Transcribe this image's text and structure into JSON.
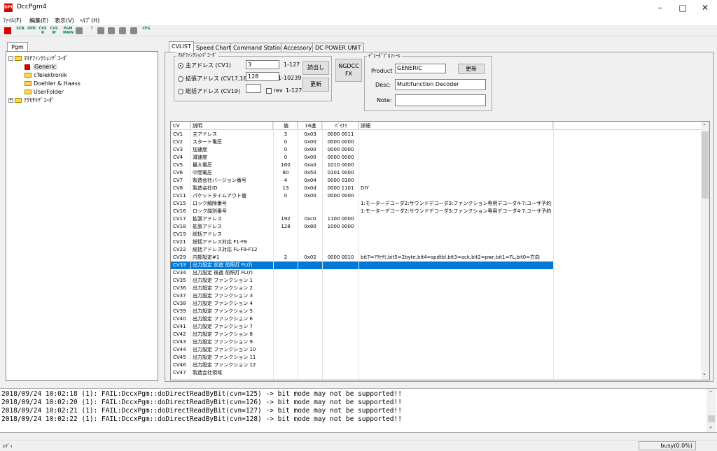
{
  "window": {
    "title": "DccPgm4",
    "icon": "DPG"
  },
  "menu": [
    "ﾌｧｲﾙ(F)",
    "編集(E)",
    "表示(V)",
    "ﾍﾙﾌﾟ(H)"
  ],
  "toolbar": [
    {
      "icon": "stop-icon",
      "label": ""
    },
    {
      "icon": "scn-icon",
      "label": "SCN"
    },
    {
      "icon": "upd-icon",
      "label": "UPD"
    },
    {
      "icon": "cvs-r-icon",
      "label": "CVS R"
    },
    {
      "icon": "cvs-w-icon",
      "label": "CVS W"
    },
    {
      "icon": "pgm-main-icon",
      "label": "PGM MAIN"
    },
    {
      "icon": "print-icon",
      "label": ""
    },
    {
      "icon": "help-icon",
      "label": "?"
    },
    {
      "icon": "copy-icon",
      "label": ""
    },
    {
      "icon": "paste-icon",
      "label": ""
    },
    {
      "icon": "save-icon",
      "label": ""
    },
    {
      "icon": "file-icon",
      "label": ""
    },
    {
      "icon": "cfg-icon",
      "label": "CFG"
    }
  ],
  "left": {
    "tab": "Pgm",
    "tree": [
      {
        "label": "ﾏﾙﾁﾌｧﾝｸｼｮﾝﾃﾞｺｰﾀﾞ",
        "level": 0,
        "expand": "-",
        "icon": "folder"
      },
      {
        "label": "Generic",
        "level": 1,
        "icon": "red",
        "selected": true
      },
      {
        "label": "cTelektronik",
        "level": 1,
        "icon": "folder"
      },
      {
        "label": "Doehler & Haass",
        "level": 1,
        "icon": "folder"
      },
      {
        "label": "UserFolder",
        "level": 1,
        "icon": "folder"
      },
      {
        "label": "ｱｸｾｻﾘﾃﾞｺｰﾀﾞ",
        "level": 0,
        "expand": "+",
        "icon": "folder"
      }
    ]
  },
  "tabs": [
    "CVLIST",
    "Speed Chart",
    "Command Station",
    "Accessory",
    "DC POWER UNIT"
  ],
  "decoder_group": {
    "title": "ﾏﾙﾁﾌｧﾝｸｼｮﾝﾃﾞｺｰﾀﾞ",
    "primary_label": "主アドレス (CV1)",
    "primary_value": "3",
    "primary_range": "1-127",
    "extended_label": "拡張アドレス (CV17,18)",
    "extended_value": "128",
    "extended_range": "1-10239",
    "consist_label": "総括アドレス (CV19)",
    "consist_value": "",
    "rev_label": "rev",
    "consist_range": "1-127",
    "read_button": "読出し",
    "update_button": "更新",
    "selected_mode": "primary"
  },
  "ngdcc_button": "NGDCC FX",
  "profile_group": {
    "title": "ﾃﾞｺｰﾀﾞﾌﾟﾛﾌｨｰﾙ",
    "product_label": "Product",
    "product_value": "GENERIC",
    "update_button": "更新",
    "desc_label": "Desc:",
    "desc_value": "Multifunction Decoder",
    "note_label": "Note:",
    "note_value": ""
  },
  "grid": {
    "headers": [
      "CV",
      "説明",
      "値",
      "16進",
      "ﾊﾞｲﾅﾘ",
      "詳細"
    ],
    "rows": [
      [
        "CV1",
        "主アドレス",
        "3",
        "0x03",
        "0000 0011",
        ""
      ],
      [
        "CV2",
        "スタート電圧",
        "0",
        "0x00",
        "0000 0000",
        ""
      ],
      [
        "CV3",
        "加速度",
        "0",
        "0x00",
        "0000 0000",
        ""
      ],
      [
        "CV4",
        "減速度",
        "0",
        "0x00",
        "0000 0000",
        ""
      ],
      [
        "CV5",
        "最大電圧",
        "160",
        "0xa0",
        "1010 0000",
        ""
      ],
      [
        "CV6",
        "中間電圧",
        "80",
        "0x50",
        "0101 0000",
        ""
      ],
      [
        "CV7",
        "製造会社バージョン番号",
        "4",
        "0x04",
        "0000 0100",
        ""
      ],
      [
        "CV8",
        "製造会社ID",
        "13",
        "0x0d",
        "0000 1101",
        "DIY"
      ],
      [
        "CV11",
        "パケットタイムアウト値",
        "0",
        "0x00",
        "0000 0000",
        ""
      ],
      [
        "CV15",
        "ロック解除番号",
        "",
        "",
        "",
        "1:モーターデコーダ2:サウンドデコーダ3:ファンクション専用デコーダ4-7:ユーザ予約"
      ],
      [
        "CV16",
        "ロック識別番号",
        "",
        "",
        "",
        "1:モーターデコーダ2:サウンドデコーダ3:ファンクション専用デコーダ4-7:ユーザ予約"
      ],
      [
        "CV17",
        "拡張アドレス",
        "192",
        "0xc0",
        "1100 0000",
        ""
      ],
      [
        "CV18",
        "拡張アドレス",
        "128",
        "0x80",
        "1000 0000",
        ""
      ],
      [
        "CV19",
        "総括アドレス",
        "",
        "",
        "",
        ""
      ],
      [
        "CV21",
        "総括アドレス対応 F1-F8",
        "",
        "",
        "",
        ""
      ],
      [
        "CV22",
        "総括アドレス対応 FL-F9-F12",
        "",
        "",
        "",
        ""
      ],
      [
        "CV29",
        "内部設定#1",
        "2",
        "0x02",
        "0000 0010",
        "bit7=ｱｸｾｻﾘ,bit5=2byte,bit4=spdtbl,bit3=ack,bit2=pwr,bit1=FL,bit0=方向"
      ],
      [
        "CV33",
        "出力設定 前進 前照灯 FL(f)",
        "",
        "",
        "",
        ""
      ],
      [
        "CV34",
        "出力設定 後進 前照灯 FL(r)",
        "",
        "",
        "",
        ""
      ],
      [
        "CV35",
        "出力設定 ファンクション 1",
        "",
        "",
        "",
        ""
      ],
      [
        "CV36",
        "出力設定 ファンクション 2",
        "",
        "",
        "",
        ""
      ],
      [
        "CV37",
        "出力設定 ファンクション 3",
        "",
        "",
        "",
        ""
      ],
      [
        "CV38",
        "出力設定 ファンクション 4",
        "",
        "",
        "",
        ""
      ],
      [
        "CV39",
        "出力設定 ファンクション 5",
        "",
        "",
        "",
        ""
      ],
      [
        "CV40",
        "出力設定 ファンクション 6",
        "",
        "",
        "",
        ""
      ],
      [
        "CV41",
        "出力設定 ファンクション 7",
        "",
        "",
        "",
        ""
      ],
      [
        "CV42",
        "出力設定 ファンクション 8",
        "",
        "",
        "",
        ""
      ],
      [
        "CV43",
        "出力設定 ファンクション 9",
        "",
        "",
        "",
        ""
      ],
      [
        "CV44",
        "出力設定 ファンクション 10",
        "",
        "",
        "",
        ""
      ],
      [
        "CV45",
        "出力設定 ファンクション 11",
        "",
        "",
        "",
        ""
      ],
      [
        "CV46",
        "出力設定 ファンクション 12",
        "",
        "",
        "",
        ""
      ],
      [
        "CV47",
        "製造会社領域",
        "",
        "",
        "",
        ""
      ]
    ],
    "selected_row": 17
  },
  "log": [
    "2018/09/24 10:02:18 (1): FAIL:DccxPgm::doDirectReadByBit(cvn=125) -> bit mode may not be supported!!",
    "2018/09/24 10:02:20 (1): FAIL:DccxPgm::doDirectReadByBit(cvn=126) -> bit mode may not be supported!!",
    "2018/09/24 10:02:21 (1): FAIL:DccxPgm::doDirectReadByBit(cvn=127) -> bit mode may not be supported!!",
    "2018/09/24 10:02:22 (1): FAIL:DccxPgm::doDirectReadByBit(cvn=128) -> bit mode may not be supported!!"
  ],
  "status": {
    "left": "ﾚﾃﾞｨ",
    "right": "busy(0.0%)"
  }
}
